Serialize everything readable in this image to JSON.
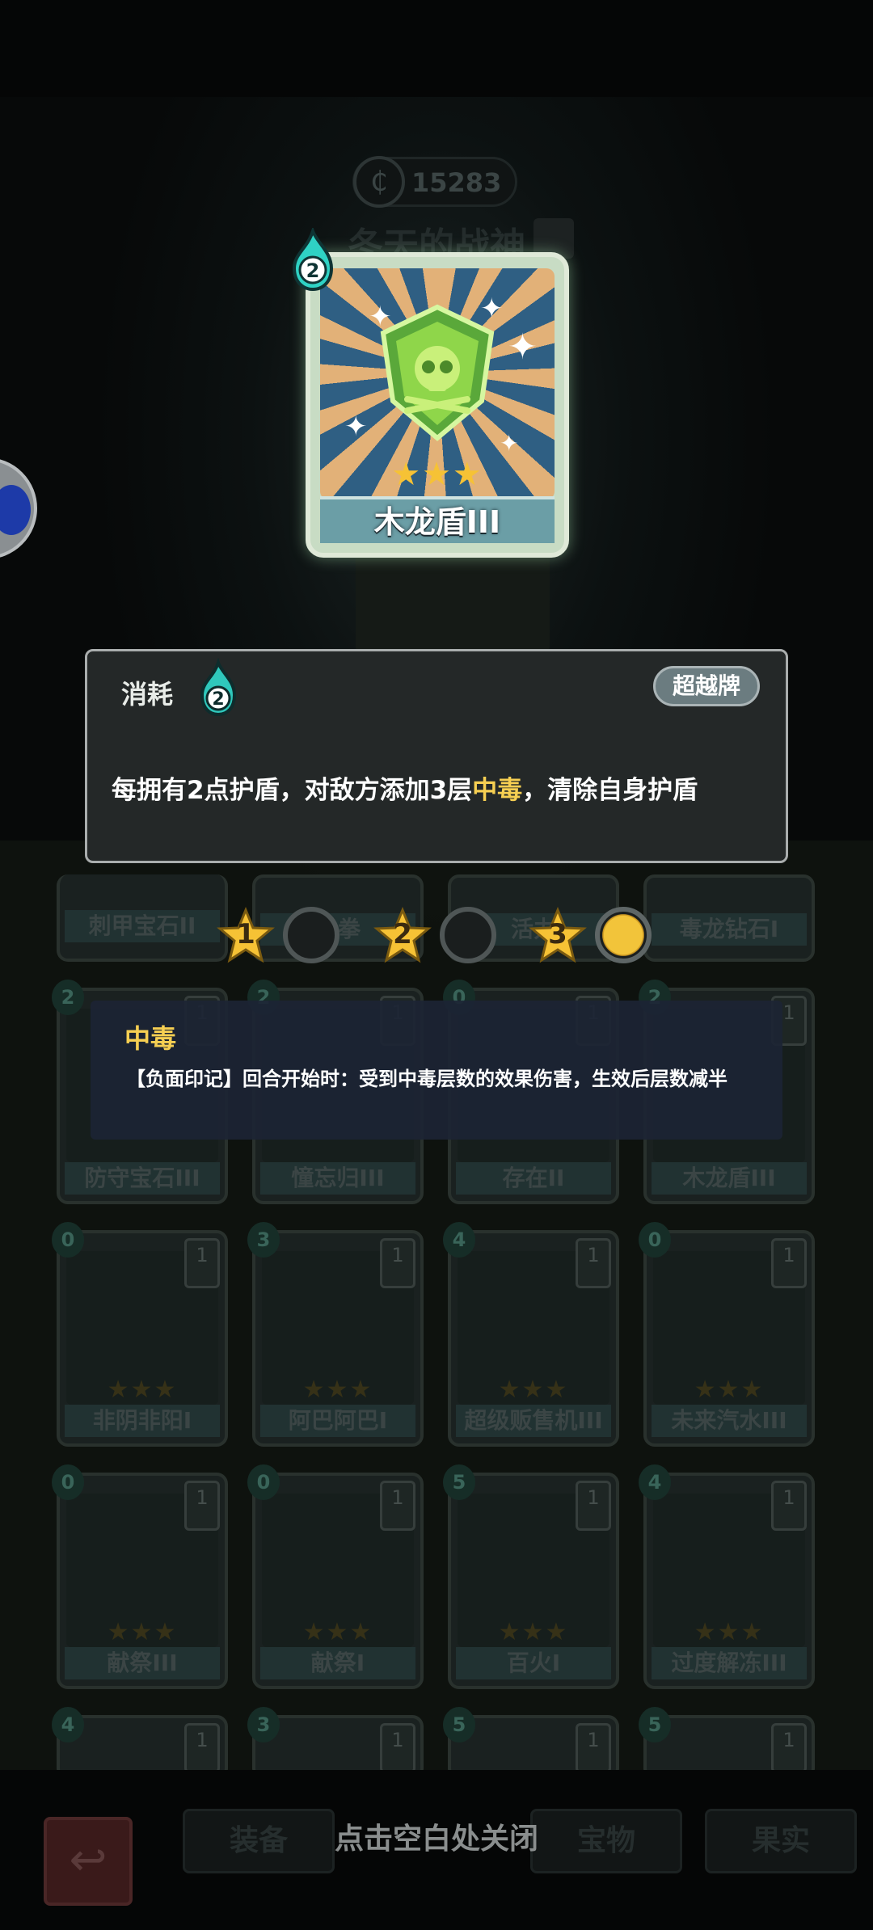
{
  "currency": {
    "value": "15283",
    "icon": "coin-icon"
  },
  "player": {
    "name": "冬天的战神"
  },
  "card": {
    "name": "木龙盾III",
    "cost": "2",
    "stars": "★★★",
    "icon": "poison-shield-icon"
  },
  "info": {
    "cost_label": "消耗",
    "cost_value": "2",
    "badge": "超越牌",
    "desc_before": "每拥有2点护盾，对敌方添加3层",
    "desc_highlight": "中毒",
    "desc_after": "，清除自身护盾"
  },
  "levels": [
    {
      "num": "1",
      "selected": false
    },
    {
      "num": "2",
      "selected": false
    },
    {
      "num": "3",
      "selected": true
    }
  ],
  "tooltip": {
    "title": "中毒",
    "text": "【负面印记】回合开始时：受到中毒层数的效果伤害，生效后层数减半"
  },
  "grid": {
    "row0": [
      "刺甲宝石II",
      "之拳",
      "活力",
      "毒龙钻石I"
    ],
    "row1": [
      {
        "name": "防守宝石III",
        "cost": "2",
        "level": "1"
      },
      {
        "name": "憧忘归III",
        "cost": "2",
        "level": "1"
      },
      {
        "name": "存在II",
        "cost": "0",
        "level": "1"
      },
      {
        "name": "木龙盾III",
        "cost": "2",
        "level": "1"
      }
    ],
    "row2": [
      {
        "name": "非阴非阳I",
        "cost": "0",
        "level": "1"
      },
      {
        "name": "阿巴阿巴I",
        "cost": "3",
        "level": "1"
      },
      {
        "name": "超级贩售机III",
        "cost": "4",
        "level": "1"
      },
      {
        "name": "未来汽水III",
        "cost": "0",
        "level": "1"
      }
    ],
    "row3": [
      {
        "name": "献祭III",
        "cost": "0",
        "level": "1"
      },
      {
        "name": "献祭I",
        "cost": "0",
        "level": "1"
      },
      {
        "name": "百火I",
        "cost": "5",
        "level": "1"
      },
      {
        "name": "过度解冻III",
        "cost": "4",
        "level": "1"
      }
    ],
    "row4": [
      {
        "cost": "4",
        "level": "1"
      },
      {
        "cost": "3",
        "level": "1"
      },
      {
        "cost": "5",
        "level": "1"
      },
      {
        "cost": "5",
        "level": "1"
      }
    ]
  },
  "nav": {
    "tabs": [
      "装备",
      "宝物",
      "果实"
    ],
    "close_hint": "点击空白处关闭"
  },
  "colors": {
    "highlight": "#f6cf52",
    "panel": "#242828",
    "card_name_bg": "#6b9ea6"
  }
}
